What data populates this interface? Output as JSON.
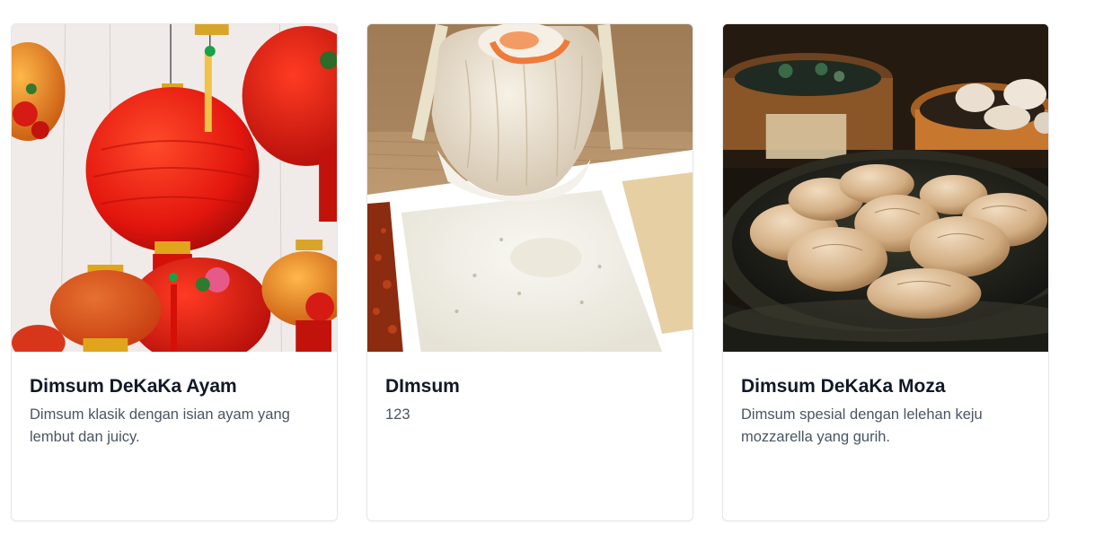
{
  "cards": [
    {
      "title": "Dimsum DeKaKa Ayam",
      "description": "Dimsum klasik dengan isian ayam yang lembut dan juicy.",
      "image": "red-lanterns-photo"
    },
    {
      "title": "DImsum",
      "description": "123",
      "image": "dumpling-dip-photo"
    },
    {
      "title": "Dimsum DeKaKa Moza",
      "description": "Dimsum spesial dengan lelehan keju mozzarella yang gurih.",
      "image": "steamer-dumplings-photo"
    }
  ]
}
